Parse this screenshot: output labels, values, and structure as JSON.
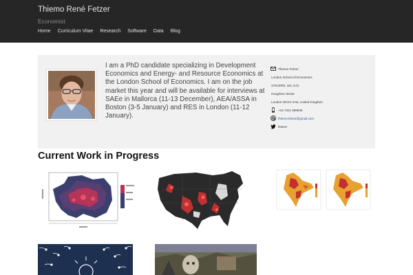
{
  "header": {
    "title": "Thiemo René Fetzer",
    "subtitle": "Economist",
    "nav": [
      "Home",
      "Curriculum Vitae",
      "Research",
      "Software",
      "Data",
      "Blog"
    ]
  },
  "hero": {
    "bio": "I am a PhD candidate specializing in Development Economics and Energy- and Resource Economics at the London School of Economics. I am on the job market this year and will be available for interviews at SAEe in Mallorca (11-13 December), AEA/ASSA in Boston (3-5 January) and RES in London (11-12 January).",
    "contact": {
      "name": "Thiemo Fetzer",
      "institution": "London School of Economics",
      "office": "STICERD, 32L 3.01",
      "street": "Houghton Street",
      "city": "London WC2A 2AE, United Kingdom",
      "phone": "+44 7411 586845",
      "email": "thiemo.fetzer@gmail.com",
      "twitter": "fetzert"
    },
    "icons": {
      "mail": "envelope-icon",
      "phone": "mobile-phone-icon",
      "email": "at-sign-icon",
      "twitter": "twitter-bird-icon"
    }
  },
  "section": {
    "title": "Current Work in Progress"
  },
  "colors": {
    "navbar": "#262626",
    "hero_bg": "#f1f1f1",
    "link": "#2255aa"
  }
}
